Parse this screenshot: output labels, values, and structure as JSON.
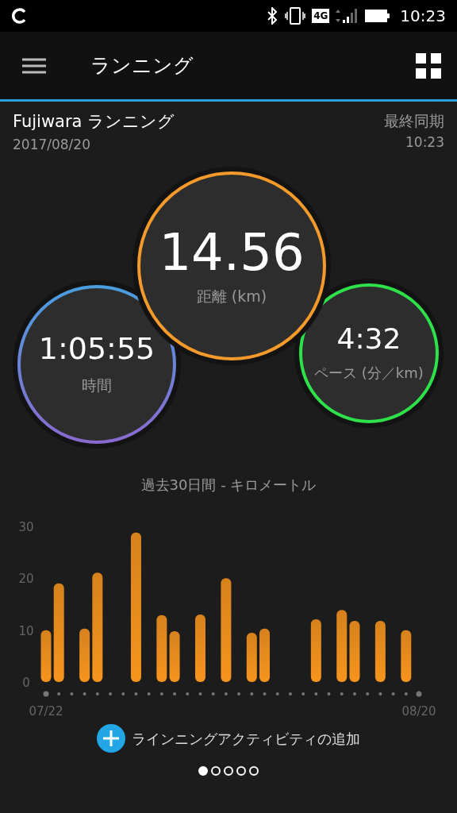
{
  "status_bar": {
    "time": "10:23",
    "network": "4G"
  },
  "app_bar": {
    "title": "ランニング"
  },
  "header": {
    "name": "Fujiwara ランニング",
    "date": "2017/08/20",
    "sync_label": "最終同期",
    "sync_time": "10:23"
  },
  "stats": [
    {
      "kind": "main",
      "value": "14.56",
      "label": "距離 (km)",
      "color": "#f39a2a"
    },
    {
      "kind": "left",
      "value": "1:05:55",
      "label": "時間",
      "color": "#4a9ee0"
    },
    {
      "kind": "right",
      "value": "4:32",
      "label": "ペース (分／km)",
      "color": "#2ee04a"
    }
  ],
  "chart": {
    "chart_data": {
      "type": "bar",
      "title": "過去30日間 - キロメートル",
      "categories": [
        "07/22",
        null,
        null,
        null,
        null,
        null,
        null,
        null,
        null,
        null,
        null,
        null,
        null,
        null,
        null,
        null,
        null,
        null,
        null,
        null,
        null,
        null,
        null,
        null,
        null,
        null,
        null,
        null,
        null,
        "08/20"
      ],
      "series": [
        {
          "color": "#f7941d",
          "values": [
            10,
            19,
            null,
            10.3,
            21.1,
            null,
            null,
            28.8,
            null,
            12.9,
            9.8,
            null,
            13,
            null,
            20,
            null,
            9.5,
            10.3,
            null,
            null,
            null,
            12.1,
            null,
            13.9,
            11.8,
            null,
            11.8,
            null,
            10,
            null
          ]
        }
      ],
      "ylim": [
        0,
        30
      ],
      "yticks": [
        0,
        10,
        20,
        30
      ]
    }
  },
  "add_button": {
    "label": "ラインニングアクティビティの追加"
  },
  "pager": [
    {
      "selected": true
    },
    {
      "selected": false
    },
    {
      "selected": false
    },
    {
      "selected": false
    },
    {
      "selected": false
    }
  ]
}
